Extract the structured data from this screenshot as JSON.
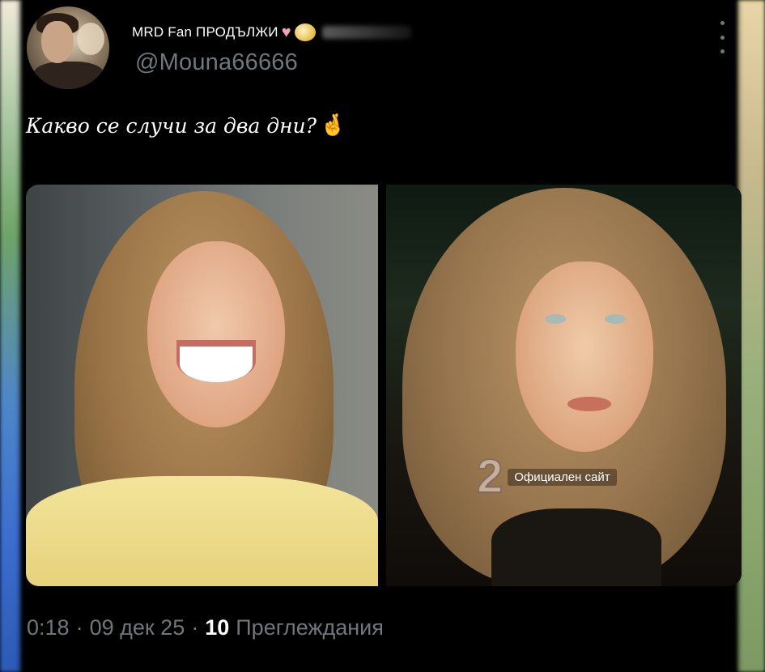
{
  "user": {
    "display_name": "MRD Fan ПРОДЪЛЖИ",
    "handle": "@Mouna66666"
  },
  "tweet": {
    "text": "Какво се случи за два дни?",
    "emoji": "🤞"
  },
  "media": {
    "watermark_text": "Официален сайт",
    "watermark_logo": "2"
  },
  "meta": {
    "time": "0:18",
    "separator": "·",
    "date": "09 дек 25",
    "views_count": "10",
    "views_label": "Преглеждания"
  },
  "icons": {
    "more": "more-vertical-icon",
    "heart": "heart-emoji-icon",
    "crossed_fingers": "crossed-fingers-emoji-icon"
  },
  "colors": {
    "background": "#000000",
    "text_primary": "#ffffff",
    "text_secondary": "#71767b"
  }
}
